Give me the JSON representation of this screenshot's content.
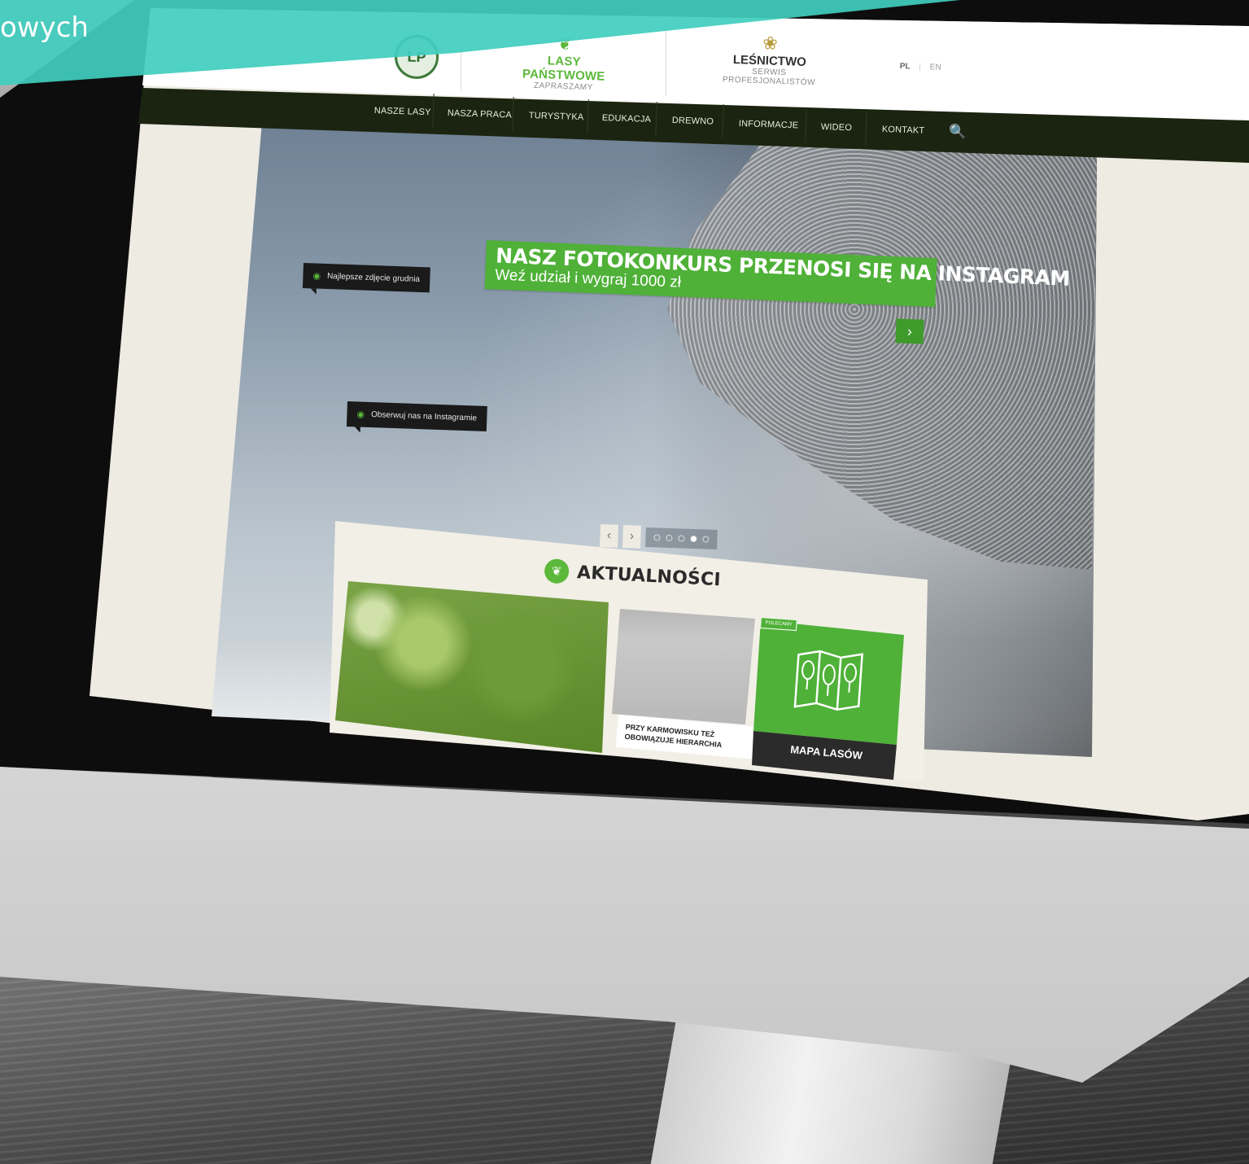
{
  "overlay": {
    "text": "owych",
    "color": "#40cdbe"
  },
  "site": {
    "logo_emblem": "LP",
    "brand1": {
      "title": "LASY PAŃSTWOWE",
      "subtitle": "ZAPRASZAMY",
      "icon": "leaf-icon"
    },
    "brand2": {
      "title": "LEŚNICTWO",
      "subtitle": "SERWIS PROFESJONALISTÓW",
      "icon": "wheat-icon"
    },
    "languages": {
      "pl": "PL",
      "separator": "|",
      "en": "EN"
    }
  },
  "nav": {
    "items": [
      "NASZE LASY",
      "NASZA PRACA",
      "TURYSTYKA",
      "EDUKACJA",
      "DREWNO",
      "INFORMACJE",
      "WIDEO",
      "KONTAKT"
    ],
    "search_icon": "🔍"
  },
  "hero": {
    "banner_title": "NASZ FOTOKONKURS PRZENOSI SIĘ NA INSTAGRAM",
    "banner_sub": "Weź udział i wygraj 1000 zł",
    "next": "›",
    "tooltip1": "Najlepsze zdjęcie grudnia",
    "tooltip2": "Obserwuj nas na Instagramie",
    "prev_arrow": "‹",
    "next_arrow": "›",
    "dots_total": 5,
    "dots_active": 4
  },
  "news": {
    "title": "AKTUALNOŚCI",
    "card2_caption": "PRZY KARMOWISKU TEŻ OBOWIĄZUJE HIERARCHIA",
    "map_badge": "POLECAMY",
    "map_label": "MAPA LASÓW"
  },
  "colors": {
    "green": "#4fb138",
    "dark_nav": "#1a2410",
    "background": "#eeebe3"
  },
  "device": {
    "apple_logo": ""
  }
}
